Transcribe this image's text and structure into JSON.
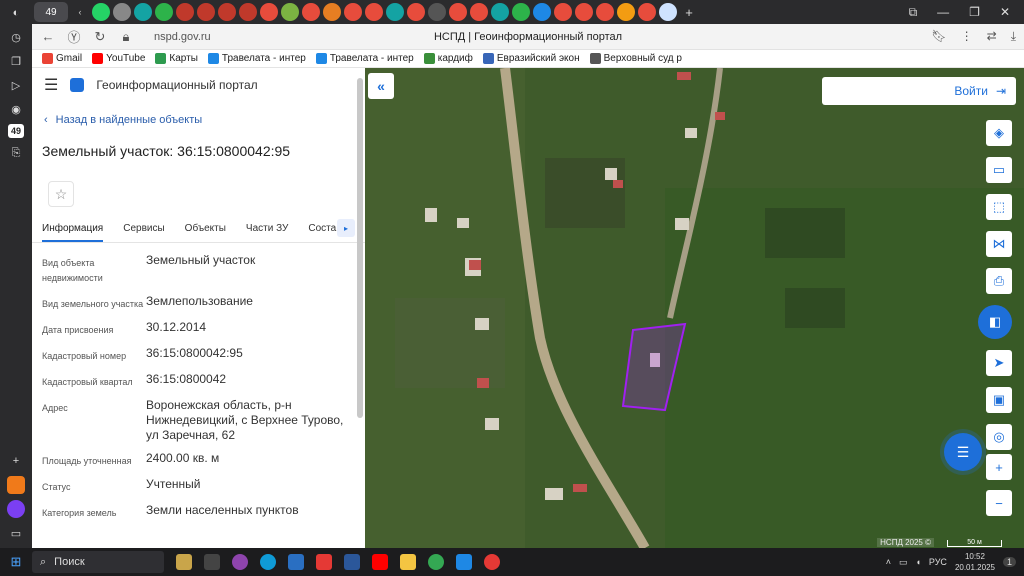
{
  "browser": {
    "url": "nspd.gov.ru",
    "page_title": "НСПД | Геоинформационный портал",
    "tab_count_badge": "49",
    "rail_badge": "49"
  },
  "bookmarks": [
    {
      "label": "Gmail",
      "color": "#ea4335"
    },
    {
      "label": "YouTube",
      "color": "#ff0000"
    },
    {
      "label": "Карты",
      "color": "#2e9b4f"
    },
    {
      "label": "Травелата - интер",
      "color": "#1e88e5"
    },
    {
      "label": "Травелата - интер",
      "color": "#1e88e5"
    },
    {
      "label": "кардиф",
      "color": "#3a8f3a"
    },
    {
      "label": "Евразийский экон",
      "color": "#3866b8"
    },
    {
      "label": "Верховный суд р",
      "color": "#555555"
    }
  ],
  "panel": {
    "app_title": "Геоинформационный портал",
    "back_link": "Назад в найденные объекты",
    "heading": "Земельный участок: 36:15:0800042:95",
    "tabs": [
      "Информация",
      "Сервисы",
      "Объекты",
      "Части ЗУ",
      "Соста"
    ],
    "rows": [
      {
        "key": "Вид объекта недвижимости",
        "value": "Земельный участок"
      },
      {
        "key": "Вид земельного участка",
        "value": "Землепользование"
      },
      {
        "key": "Дата присвоения",
        "value": "30.12.2014"
      },
      {
        "key": "Кадастровый номер",
        "value": "36:15:0800042:95"
      },
      {
        "key": "Кадастровый квартал",
        "value": "36:15:0800042"
      },
      {
        "key": "Адрес",
        "value": "Воронежская область, р-н Нижнедевицкий, с Верхнее Турово, ул Заречная, 62"
      },
      {
        "key": "Площадь уточненная",
        "value": "2400.00 кв. м"
      },
      {
        "key": "Статус",
        "value": "Учтенный"
      },
      {
        "key": "Категория земель",
        "value": "Земли населенных пунктов"
      }
    ]
  },
  "map": {
    "login_label": "Войти",
    "copyright": "НСПД 2025 ©",
    "scale_label": "50 м",
    "parcel_color": "#a020f0"
  },
  "taskbar": {
    "search_label": "Поиск",
    "lang": "РУС",
    "time": "10:52",
    "date": "20.01.2025",
    "notif": "1"
  }
}
